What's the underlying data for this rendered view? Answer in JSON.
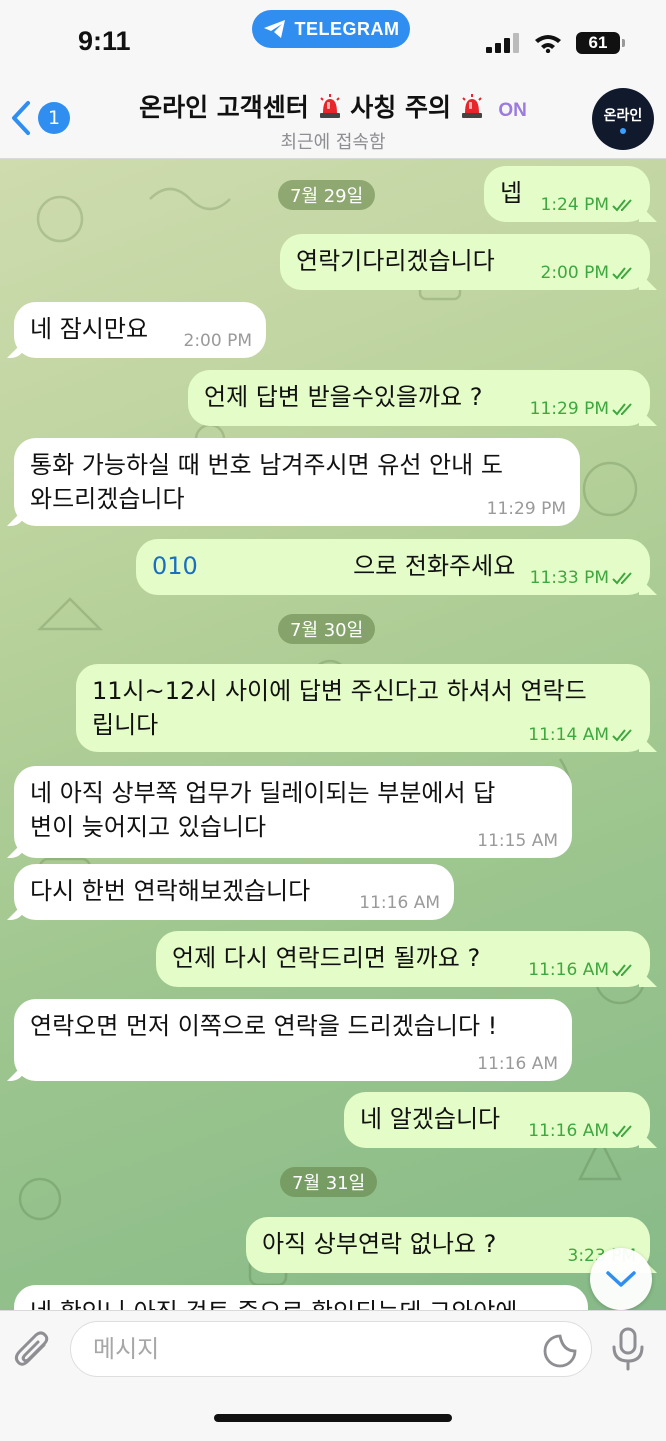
{
  "status_bar": {
    "time": "9:11",
    "app_pill": "TELEGRAM",
    "battery": "61"
  },
  "header": {
    "back_count": "1",
    "title": "온라인 고객센터",
    "title_warning": "사칭 주의",
    "title_on": "ON",
    "subtitle": "최근에 접속함",
    "avatar_text": "온라인"
  },
  "messages": [
    {
      "type": "date",
      "text": "7월 29일"
    },
    {
      "dir": "out",
      "text": "넵",
      "time": "1:24 PM"
    },
    {
      "dir": "out",
      "text": "연락기다리겠습니다",
      "time": "2:00 PM"
    },
    {
      "dir": "in",
      "text": "네 잠시만요",
      "time": "2:00 PM"
    },
    {
      "dir": "out",
      "text": "언제 답변 받을수있을까요 ?",
      "time": "11:29 PM"
    },
    {
      "dir": "in",
      "text": "통화 가능하실 때 번호 남겨주시면 유선 안내 도와드리겠습니다",
      "line1": "통화 가능하실 때 번호 남겨주시면 유선 안내 도",
      "line2": "와드리겠습니다",
      "time": "11:29 PM"
    },
    {
      "dir": "out",
      "phone": "010",
      "text": "으로 전화주세요",
      "time": "11:33 PM"
    },
    {
      "type": "date",
      "text": "7월 30일"
    },
    {
      "dir": "out",
      "text": "11시~12시 사이에 답변 주신다고 하셔서 연락드립니다",
      "line1": "11시~12시 사이에 답변 주신다고 하셔서 연락드",
      "line2": "립니다",
      "time": "11:14 AM"
    },
    {
      "dir": "in",
      "text": "네 아직 상부쪽 업무가 딜레이되는 부분에서 답변이 늦어지고 있습니다",
      "line1": "네 아직 상부쪽 업무가 딜레이되는 부분에서 답",
      "line2": "변이 늦어지고 있습니다",
      "time": "11:15 AM"
    },
    {
      "dir": "in",
      "text": "다시 한번 연락해보겠습니다",
      "time": "11:16 AM"
    },
    {
      "dir": "out",
      "text": "언제 다시 연락드리면 될까요 ?",
      "time": "11:16 AM"
    },
    {
      "dir": "in",
      "text": "연락오면 먼저 이쪽으로 연락을 드리겠습니다 !",
      "time": "11:16 AM"
    },
    {
      "dir": "out",
      "text": "네 알겠습니다",
      "time": "11:16 AM"
    },
    {
      "type": "date",
      "text": "7월 31일"
    },
    {
      "dir": "out",
      "text": "아직 상부연락 없나요 ?",
      "time": "3:23 PM"
    },
    {
      "dir": "in",
      "text": "네 확인니 아직 검토 중으로 확인되는데 그와야에"
    }
  ],
  "input": {
    "placeholder": "메시지",
    "value": ""
  },
  "icons": {
    "back": "chevron-left-icon",
    "siren": "siren-icon",
    "attach": "paperclip-icon",
    "sticker": "sticker-icon",
    "mic": "microphone-icon",
    "scroll": "chevron-down-icon",
    "read": "double-check-icon"
  },
  "colors": {
    "accent": "#2f8ef0",
    "out_bubble": "#e4fdc8",
    "in_bubble": "#ffffff",
    "check": "#3fa73f"
  }
}
